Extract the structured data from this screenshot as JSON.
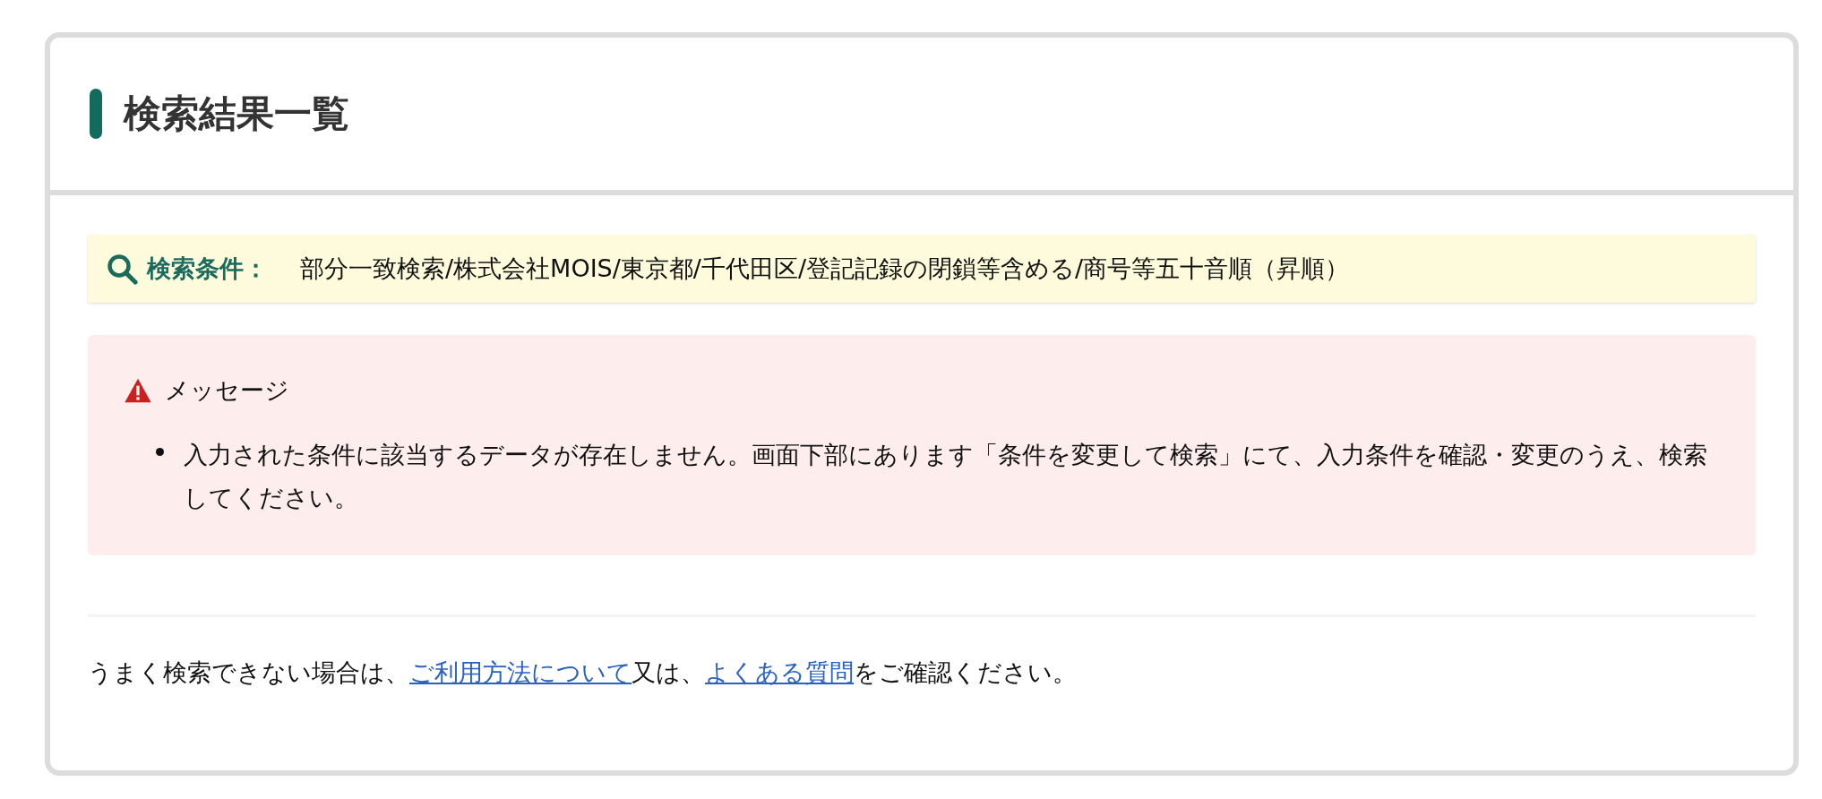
{
  "panel": {
    "title": "検索結果一覧"
  },
  "search_conditions": {
    "label": "検索条件：",
    "value": "部分一致検索/株式会社MOIS/東京都/千代田区/登記記録の閉鎖等含める/商号等五十音順（昇順）"
  },
  "message": {
    "title": "メッセージ",
    "items": [
      "入力された条件に該当するデータが存在しません。画面下部にあります「条件を変更して検索」にて、入力条件を確認・変更のうえ、検索してください。"
    ]
  },
  "help": {
    "parts": [
      {
        "kind": "text",
        "text": "うまく検索できない場合は、"
      },
      {
        "kind": "link",
        "text": "ご利用方法について"
      },
      {
        "kind": "text",
        "text": "又は、"
      },
      {
        "kind": "link",
        "text": "よくある質問"
      },
      {
        "kind": "text",
        "text": "をご確認ください。"
      }
    ]
  }
}
